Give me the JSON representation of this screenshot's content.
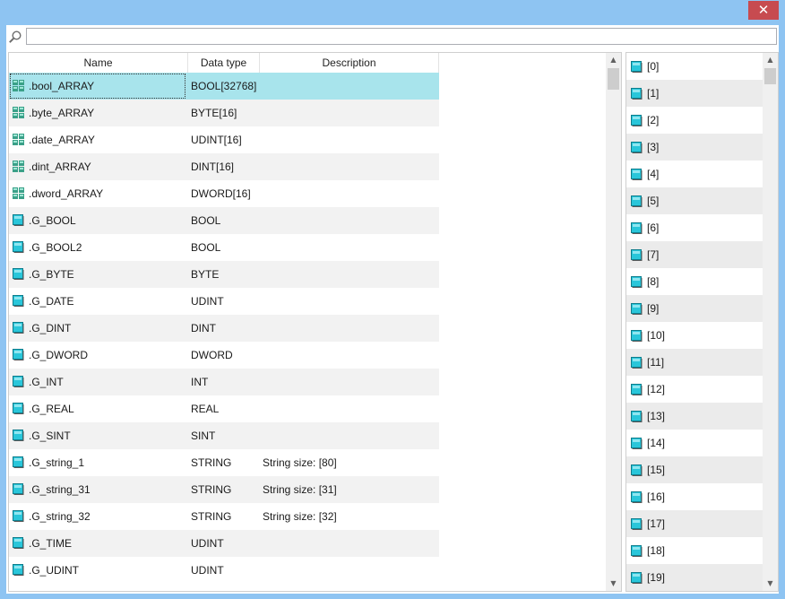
{
  "window": {
    "close_glyph": "✕"
  },
  "search": {
    "value": "",
    "placeholder": ""
  },
  "table": {
    "columns": {
      "name": "Name",
      "datatype": "Data type",
      "description": "Description"
    },
    "rows": [
      {
        "name": ".bool_ARRAY",
        "datatype": "BOOL[32768]",
        "description": "",
        "icon": "array-icon"
      },
      {
        "name": ".byte_ARRAY",
        "datatype": "BYTE[16]",
        "description": "",
        "icon": "array-icon"
      },
      {
        "name": ".date_ARRAY",
        "datatype": "UDINT[16]",
        "description": "",
        "icon": "array-icon"
      },
      {
        "name": ".dint_ARRAY",
        "datatype": "DINT[16]",
        "description": "",
        "icon": "array-icon"
      },
      {
        "name": ".dword_ARRAY",
        "datatype": "DWORD[16]",
        "description": "",
        "icon": "array-icon"
      },
      {
        "name": ".G_BOOL",
        "datatype": "BOOL",
        "description": "",
        "icon": "variable-icon"
      },
      {
        "name": ".G_BOOL2",
        "datatype": "BOOL",
        "description": "",
        "icon": "variable-icon"
      },
      {
        "name": ".G_BYTE",
        "datatype": "BYTE",
        "description": "",
        "icon": "variable-icon"
      },
      {
        "name": ".G_DATE",
        "datatype": "UDINT",
        "description": "",
        "icon": "variable-icon"
      },
      {
        "name": ".G_DINT",
        "datatype": "DINT",
        "description": "",
        "icon": "variable-icon"
      },
      {
        "name": ".G_DWORD",
        "datatype": "DWORD",
        "description": "",
        "icon": "variable-icon"
      },
      {
        "name": ".G_INT",
        "datatype": "INT",
        "description": "",
        "icon": "variable-icon"
      },
      {
        "name": ".G_REAL",
        "datatype": "REAL",
        "description": "",
        "icon": "variable-icon"
      },
      {
        "name": ".G_SINT",
        "datatype": "SINT",
        "description": "",
        "icon": "variable-icon"
      },
      {
        "name": ".G_string_1",
        "datatype": "STRING",
        "description": "String size: [80]",
        "icon": "variable-icon"
      },
      {
        "name": ".G_string_31",
        "datatype": "STRING",
        "description": "String size: [31]",
        "icon": "variable-icon"
      },
      {
        "name": ".G_string_32",
        "datatype": "STRING",
        "description": "String size: [32]",
        "icon": "variable-icon"
      },
      {
        "name": ".G_TIME",
        "datatype": "UDINT",
        "description": "",
        "icon": "variable-icon"
      },
      {
        "name": ".G_UDINT",
        "datatype": "UDINT",
        "description": "",
        "icon": "variable-icon"
      }
    ],
    "selected_index": 0
  },
  "index_list": {
    "items": [
      "[0]",
      "[1]",
      "[2]",
      "[3]",
      "[4]",
      "[5]",
      "[6]",
      "[7]",
      "[8]",
      "[9]",
      "[10]",
      "[11]",
      "[12]",
      "[13]",
      "[14]",
      "[15]",
      "[16]",
      "[17]",
      "[18]",
      "[19]"
    ]
  },
  "colors": {
    "selected_row": "#a8e4ec",
    "alt_row": "#f2f2f2",
    "title_bar": "#8ec4f2",
    "close_button": "#c74b50",
    "icon_cyan": "#29c6da",
    "icon_array": "#3aa088"
  },
  "icons": {
    "search": "search-icon",
    "array": "array-icon",
    "variable": "variable-icon",
    "scroll_up": "▲",
    "scroll_down": "▼"
  }
}
